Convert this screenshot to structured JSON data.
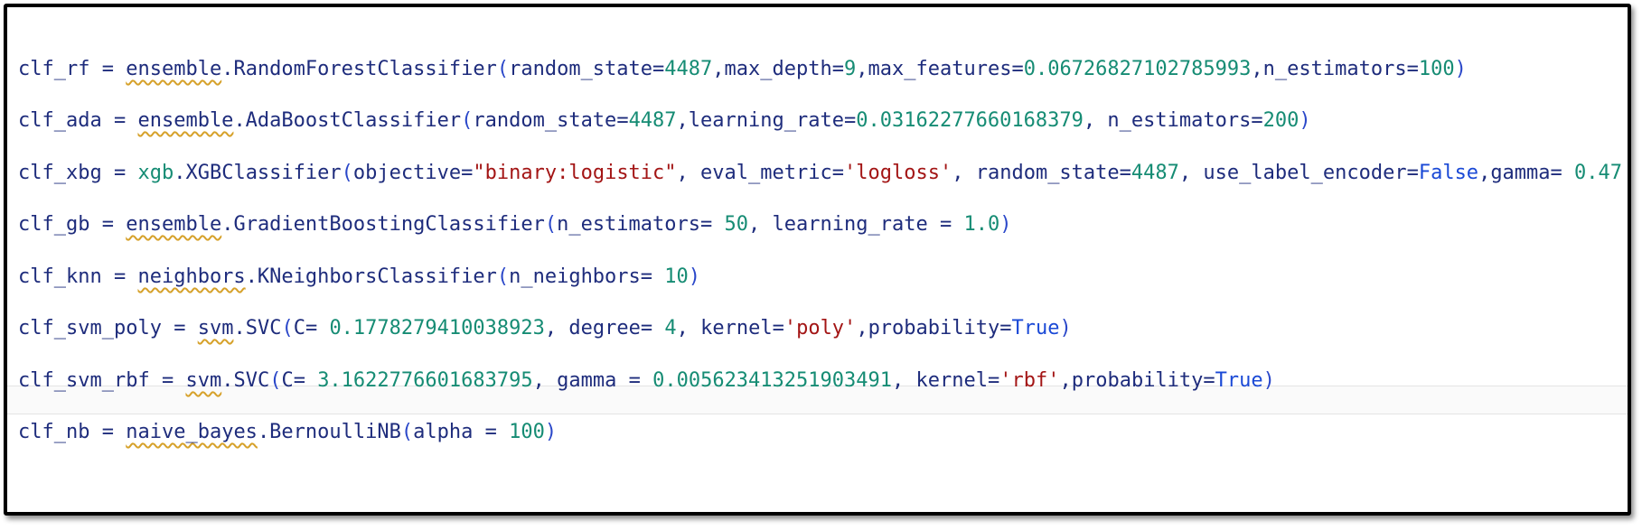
{
  "code_lines": [
    [
      {
        "t": "clf_rf",
        "c": "var"
      },
      {
        "t": " = ",
        "c": "op"
      },
      {
        "t": "ensemble",
        "c": "mod"
      },
      {
        "t": ".RandomForestClassifier",
        "c": "cls"
      },
      {
        "t": "(",
        "c": "paren"
      },
      {
        "t": "random_state",
        "c": "kw"
      },
      {
        "t": "=",
        "c": "op"
      },
      {
        "t": "4487",
        "c": "num"
      },
      {
        "t": ",",
        "c": "op"
      },
      {
        "t": "max_depth",
        "c": "kw"
      },
      {
        "t": "=",
        "c": "op"
      },
      {
        "t": "9",
        "c": "num"
      },
      {
        "t": ",",
        "c": "op"
      },
      {
        "t": "max_features",
        "c": "kw"
      },
      {
        "t": "=",
        "c": "op"
      },
      {
        "t": "0.06726827102785993",
        "c": "num"
      },
      {
        "t": ",",
        "c": "op"
      },
      {
        "t": "n_estimators",
        "c": "kw"
      },
      {
        "t": "=",
        "c": "op"
      },
      {
        "t": "100",
        "c": "num"
      },
      {
        "t": ")",
        "c": "paren"
      }
    ],
    [
      {
        "t": "clf_ada",
        "c": "var"
      },
      {
        "t": " = ",
        "c": "op"
      },
      {
        "t": "ensemble",
        "c": "mod"
      },
      {
        "t": ".AdaBoostClassifier",
        "c": "cls"
      },
      {
        "t": "(",
        "c": "paren"
      },
      {
        "t": "random_state",
        "c": "kw"
      },
      {
        "t": "=",
        "c": "op"
      },
      {
        "t": "4487",
        "c": "num"
      },
      {
        "t": ",",
        "c": "op"
      },
      {
        "t": "learning_rate",
        "c": "kw"
      },
      {
        "t": "=",
        "c": "op"
      },
      {
        "t": "0.03162277660168379",
        "c": "num"
      },
      {
        "t": ", ",
        "c": "op"
      },
      {
        "t": "n_estimators",
        "c": "kw"
      },
      {
        "t": "=",
        "c": "op"
      },
      {
        "t": "200",
        "c": "num"
      },
      {
        "t": ")",
        "c": "paren"
      }
    ],
    [
      {
        "t": "clf_xbg",
        "c": "var"
      },
      {
        "t": " = ",
        "c": "op"
      },
      {
        "t": "xgb",
        "c": "xgb"
      },
      {
        "t": ".XGBClassifier",
        "c": "cls"
      },
      {
        "t": "(",
        "c": "paren"
      },
      {
        "t": "objective",
        "c": "kw"
      },
      {
        "t": "=",
        "c": "op"
      },
      {
        "t": "\"binary:logistic\"",
        "c": "str"
      },
      {
        "t": ", ",
        "c": "op"
      },
      {
        "t": "eval_metric",
        "c": "kw"
      },
      {
        "t": "=",
        "c": "op"
      },
      {
        "t": "'logloss'",
        "c": "str"
      },
      {
        "t": ", ",
        "c": "op"
      },
      {
        "t": "random_state",
        "c": "kw"
      },
      {
        "t": "=",
        "c": "op"
      },
      {
        "t": "4487",
        "c": "num"
      },
      {
        "t": ", ",
        "c": "op"
      },
      {
        "t": "use_label_encoder",
        "c": "kw"
      },
      {
        "t": "=",
        "c": "op"
      },
      {
        "t": "False",
        "c": "bool"
      },
      {
        "t": ",",
        "c": "op"
      },
      {
        "t": "gamma",
        "c": "kw"
      },
      {
        "t": "= ",
        "c": "op"
      },
      {
        "t": "0.47",
        "c": "num"
      }
    ],
    [
      {
        "t": "clf_gb",
        "c": "var"
      },
      {
        "t": " = ",
        "c": "op"
      },
      {
        "t": "ensemble",
        "c": "mod"
      },
      {
        "t": ".GradientBoostingClassifier",
        "c": "cls"
      },
      {
        "t": "(",
        "c": "paren"
      },
      {
        "t": "n_estimators",
        "c": "kw"
      },
      {
        "t": "= ",
        "c": "op"
      },
      {
        "t": "50",
        "c": "num"
      },
      {
        "t": ", ",
        "c": "op"
      },
      {
        "t": "learning_rate",
        "c": "kw"
      },
      {
        "t": " = ",
        "c": "op"
      },
      {
        "t": "1.0",
        "c": "num"
      },
      {
        "t": ")",
        "c": "paren"
      }
    ],
    [
      {
        "t": "clf_knn",
        "c": "var"
      },
      {
        "t": " = ",
        "c": "op"
      },
      {
        "t": "neighbors",
        "c": "mod"
      },
      {
        "t": ".KNeighborsClassifier",
        "c": "cls"
      },
      {
        "t": "(",
        "c": "paren"
      },
      {
        "t": "n_neighbors",
        "c": "kw"
      },
      {
        "t": "= ",
        "c": "op"
      },
      {
        "t": "10",
        "c": "num"
      },
      {
        "t": ")",
        "c": "paren"
      }
    ],
    [
      {
        "t": "clf_svm_poly",
        "c": "var"
      },
      {
        "t": " = ",
        "c": "op"
      },
      {
        "t": "svm",
        "c": "mod"
      },
      {
        "t": ".SVC",
        "c": "cls"
      },
      {
        "t": "(",
        "c": "paren"
      },
      {
        "t": "C",
        "c": "kw"
      },
      {
        "t": "= ",
        "c": "op"
      },
      {
        "t": "0.1778279410038923",
        "c": "num"
      },
      {
        "t": ", ",
        "c": "op"
      },
      {
        "t": "degree",
        "c": "kw"
      },
      {
        "t": "= ",
        "c": "op"
      },
      {
        "t": "4",
        "c": "num"
      },
      {
        "t": ", ",
        "c": "op"
      },
      {
        "t": "kernel",
        "c": "kw"
      },
      {
        "t": "=",
        "c": "op"
      },
      {
        "t": "'poly'",
        "c": "str"
      },
      {
        "t": ",",
        "c": "op"
      },
      {
        "t": "probability",
        "c": "kw"
      },
      {
        "t": "=",
        "c": "op"
      },
      {
        "t": "True",
        "c": "bool"
      },
      {
        "t": ")",
        "c": "paren"
      }
    ],
    [
      {
        "t": "clf_svm_rbf",
        "c": "var"
      },
      {
        "t": " = ",
        "c": "op"
      },
      {
        "t": "svm",
        "c": "mod"
      },
      {
        "t": ".SVC",
        "c": "cls"
      },
      {
        "t": "(",
        "c": "paren"
      },
      {
        "t": "C",
        "c": "kw"
      },
      {
        "t": "= ",
        "c": "op"
      },
      {
        "t": "3.1622776601683795",
        "c": "num"
      },
      {
        "t": ", ",
        "c": "op"
      },
      {
        "t": "gamma",
        "c": "kw"
      },
      {
        "t": " = ",
        "c": "op"
      },
      {
        "t": "0.005623413251903491",
        "c": "num"
      },
      {
        "t": ", ",
        "c": "op"
      },
      {
        "t": "kernel",
        "c": "kw"
      },
      {
        "t": "=",
        "c": "op"
      },
      {
        "t": "'rbf'",
        "c": "str"
      },
      {
        "t": ",",
        "c": "op"
      },
      {
        "t": "probability",
        "c": "kw"
      },
      {
        "t": "=",
        "c": "op"
      },
      {
        "t": "True",
        "c": "bool"
      },
      {
        "t": ")",
        "c": "paren"
      }
    ],
    [
      {
        "t": "clf_nb",
        "c": "var"
      },
      {
        "t": " = ",
        "c": "op"
      },
      {
        "t": "naive_bayes",
        "c": "mod"
      },
      {
        "t": ".BernoulliNB",
        "c": "cls"
      },
      {
        "t": "(",
        "c": "paren"
      },
      {
        "t": "alpha",
        "c": "kw"
      },
      {
        "t": " = ",
        "c": "op"
      },
      {
        "t": "100",
        "c": "num"
      },
      {
        "t": ")",
        "c": "paren"
      }
    ]
  ]
}
